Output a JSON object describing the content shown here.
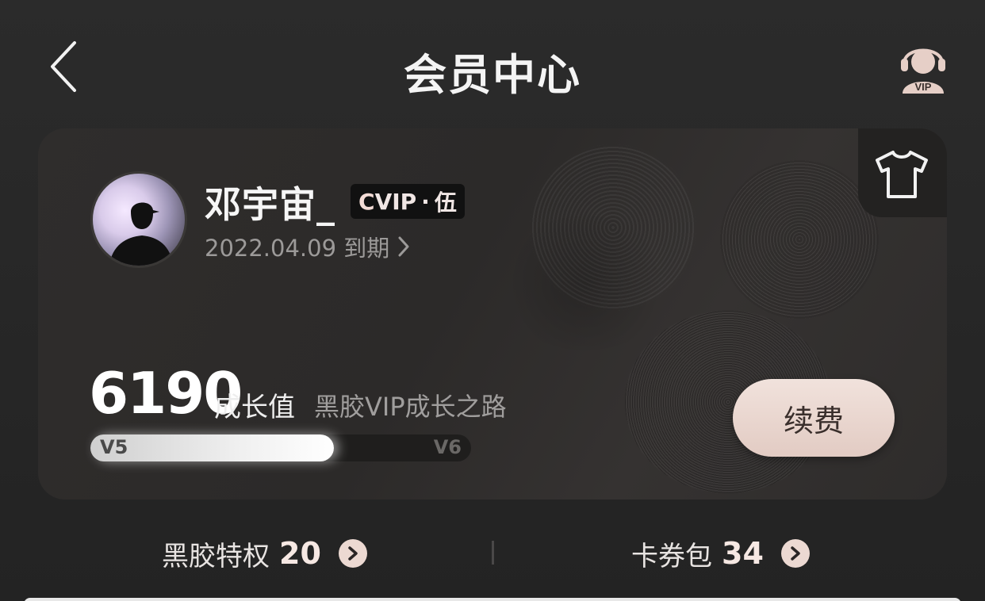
{
  "header": {
    "title": "会员中心",
    "service_icon_text": "VIP"
  },
  "card": {
    "username": "邓宇宙_",
    "badge": {
      "prefix": "C",
      "vip": "VIP",
      "dot": "·",
      "level": "伍"
    },
    "expire_text": "2022.04.09 到期",
    "growth_value": "6190",
    "growth_label": "成长值",
    "growth_road": "黑胶VIP成长之路",
    "progress": {
      "from": "V5",
      "to": "V6",
      "fraction": 0.64
    },
    "renew_label": "续费"
  },
  "bottom": {
    "privilege_label": "黑胶特权",
    "privilege_count": "20",
    "coupon_label": "卡券包",
    "coupon_count": "34"
  },
  "colors": {
    "background": "#262626",
    "accent_pink": "#ecd9d2",
    "badge_bg": "#111111"
  }
}
